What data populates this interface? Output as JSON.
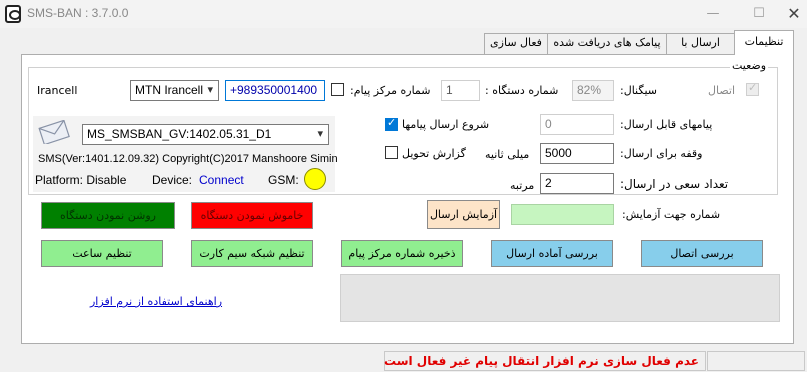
{
  "window": {
    "title": "SMS-BAN : 3.7.0.0",
    "minimize": "—",
    "maximize": "☐",
    "close": "✕"
  },
  "tabs": [
    {
      "label": "تنظیمات",
      "active": true
    },
    {
      "label": "ارسال با اکسل",
      "active": false
    },
    {
      "label": "پیامک های دریافت شده",
      "active": false
    },
    {
      "label": "فعال سازی",
      "active": false
    }
  ],
  "status_group": {
    "title": "وضعیت"
  },
  "operator": {
    "label": "Irancell",
    "selected": "MTN Irancell"
  },
  "service_center": {
    "value": "+989350001400",
    "checkbox_label": "شماره مرکز پیام:",
    "checked": false
  },
  "device_number": {
    "label": "شماره دستگاه :",
    "value": "1"
  },
  "signal": {
    "label": "سیگنال:",
    "value": "82%"
  },
  "connection": {
    "label": "اتصال",
    "checked": true
  },
  "port": {
    "selected": "MS_SMSBAN_GV:1402.05.31_D1"
  },
  "device_info": {
    "version_text": "SMS(Ver:1401.12.09.32) Copyright(C)2017 Manshoore Simin",
    "platform": "Platform: Disable",
    "device_label": "Device:",
    "device_status": "Connect",
    "gsm_label": "GSM:",
    "gsm_color": "#ffff00",
    "link_color": "#0000cc"
  },
  "start_sending": {
    "label": "شروع ارسال پیامها",
    "checked": true
  },
  "delivery_report": {
    "label": "گزارش تحویل",
    "checked": false
  },
  "sendable_messages": {
    "label": "پیامهای قابل ارسال:",
    "value": "0"
  },
  "send_interval": {
    "label": "وقفه برای ارسال:",
    "value": "5000",
    "unit": "میلی ثانیه"
  },
  "retry_count": {
    "label": "تعداد سعی در ارسال:",
    "value": "2",
    "unit": "مرتبه"
  },
  "test_number": {
    "label": "شماره جهت آزمایش:",
    "value": ""
  },
  "buttons": {
    "power_on": "روشن نمودن دستگاه",
    "power_off": "خاموش نمودن دستگاه",
    "test_send": "آزمایش ارسال",
    "set_clock": "تنظیم ساعت",
    "set_sim_network": "تنظیم شبکه سیم کارت",
    "save_center_number": "ذخیره شماره مرکز پیام",
    "check_ready": "بررسی آماده ارسال",
    "check_connection": "بررسی اتصال"
  },
  "help_link": "راهنمای استفاده از نرم افزار",
  "statusbar": {
    "message": "عدم فعال سازی نرم افزار  انتقال پیام غیر فعال است",
    "message_color": "#e00000"
  },
  "colors": {
    "green_dark": "#008000",
    "red": "#ff0000",
    "light_green": "#90ee90",
    "light_blue": "#87ceeb",
    "peach": "#fde4c8"
  }
}
